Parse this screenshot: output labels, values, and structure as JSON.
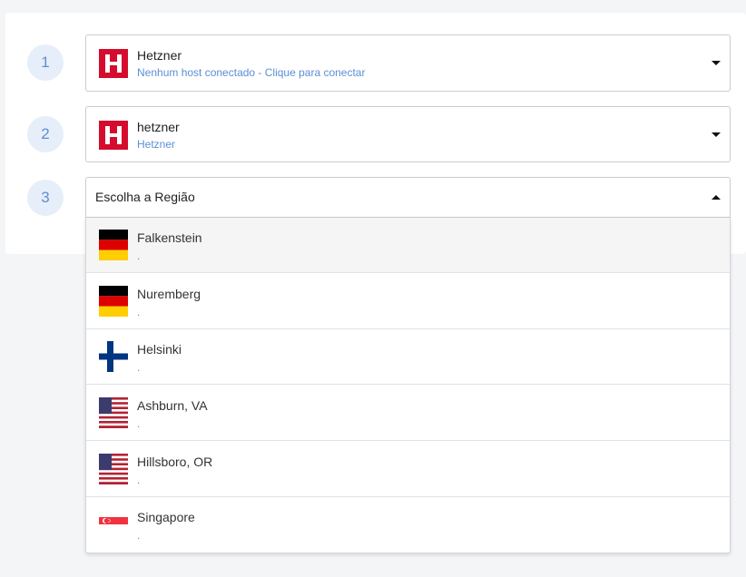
{
  "steps": [
    {
      "number": "1"
    },
    {
      "number": "2"
    },
    {
      "number": "3"
    }
  ],
  "provider_select": {
    "icon": "hetzner-logo",
    "title": "Hetzner",
    "subtitle": "Nenhum host conectado - Clique para conectar"
  },
  "account_select": {
    "icon": "hetzner-logo",
    "title": "hetzner",
    "subtitle": "Hetzner"
  },
  "region_select": {
    "placeholder": "Escolha a Região",
    "expanded": true
  },
  "regions": [
    {
      "name": "Falkenstein",
      "detail": ".",
      "flag": "germany-flag",
      "highlighted": true
    },
    {
      "name": "Nuremberg",
      "detail": ".",
      "flag": "germany-flag"
    },
    {
      "name": "Helsinki",
      "detail": ".",
      "flag": "finland-flag"
    },
    {
      "name": "Ashburn, VA",
      "detail": ".",
      "flag": "usa-flag"
    },
    {
      "name": "Hillsboro, OR",
      "detail": ".",
      "flag": "usa-flag"
    },
    {
      "name": "Singapore",
      "detail": ".",
      "flag": "singapore-flag"
    }
  ],
  "colors": {
    "brand_red": "#d50c2d",
    "accent_blue": "#5a8fd6",
    "step_bg": "#e6eef9"
  }
}
